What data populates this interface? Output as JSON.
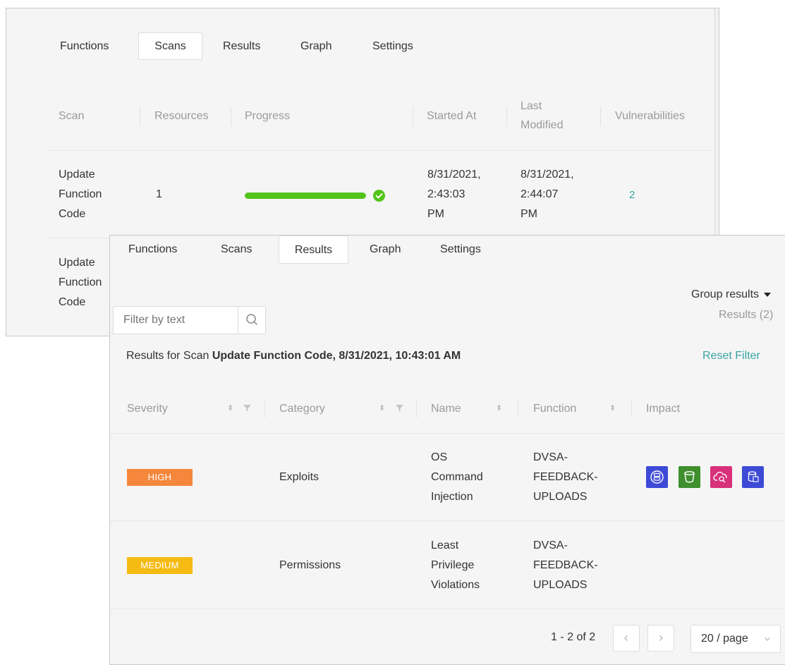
{
  "back_panel": {
    "tabs": [
      {
        "label": "Functions",
        "active": false
      },
      {
        "label": "Scans",
        "active": true
      },
      {
        "label": "Results",
        "active": false
      },
      {
        "label": "Graph",
        "active": false
      },
      {
        "label": "Settings",
        "active": false
      }
    ],
    "columns": {
      "scan": "Scan",
      "resources": "Resources",
      "progress": "Progress",
      "started_at": "Started At",
      "last_modified_1": "Last",
      "last_modified_2": "Modified",
      "vulnerabilities": "Vulnerabilities"
    },
    "rows": [
      {
        "scan_lines": [
          "Update",
          "Function",
          "Code"
        ],
        "resources": "1",
        "progress_percent": 100,
        "started_lines": [
          "8/31/2021,",
          "2:43:03",
          "PM"
        ],
        "modified_lines": [
          "8/31/2021,",
          "2:44:07",
          "PM"
        ],
        "vulnerabilities": "2"
      },
      {
        "scan_lines": [
          "Update",
          "Function",
          "Code"
        ]
      }
    ]
  },
  "front_panel": {
    "tabs": [
      {
        "label": "Functions",
        "active": false
      },
      {
        "label": "Scans",
        "active": false
      },
      {
        "label": "Results",
        "active": true
      },
      {
        "label": "Graph",
        "active": false
      },
      {
        "label": "Settings",
        "active": false
      }
    ],
    "group_results_label": "Group results",
    "results_count": "Results (2)",
    "filter_placeholder": "Filter by text",
    "results_for_prefix": "Results for Scan ",
    "results_for_scan": "Update Function Code, 8/31/2021, 10:43:01 AM",
    "reset_filter": "Reset Filter",
    "columns": {
      "severity": "Severity",
      "category": "Category",
      "name": "Name",
      "function": "Function",
      "impact": "Impact"
    },
    "rows": [
      {
        "severity": "HIGH",
        "severity_color": "#f5873c",
        "category": "Exploits",
        "name_lines": [
          "OS",
          "Command",
          "Injection"
        ],
        "function_lines": [
          "DVSA-",
          "FEEDBACK-",
          "UPLOADS"
        ],
        "impact_icons": [
          {
            "name": "database-service-icon",
            "color": "#3d4ad6"
          },
          {
            "name": "storage-bucket-icon",
            "color": "#3f8f2e"
          },
          {
            "name": "cloud-search-icon",
            "color": "#d8307a"
          },
          {
            "name": "database-table-icon",
            "color": "#3d4ad6"
          }
        ]
      },
      {
        "severity": "MEDIUM",
        "severity_color": "#f5bb13",
        "category": "Permissions",
        "name_lines": [
          "Least",
          "Privilege",
          "Violations"
        ],
        "function_lines": [
          "DVSA-",
          "FEEDBACK-",
          "UPLOADS"
        ],
        "impact_icons": []
      }
    ],
    "pagination": {
      "range": "1 - 2",
      "of_label": "of 2",
      "page_size": "20 / page",
      "prev_icon": "chevron-left-icon",
      "next_icon": "chevron-right-icon"
    }
  }
}
